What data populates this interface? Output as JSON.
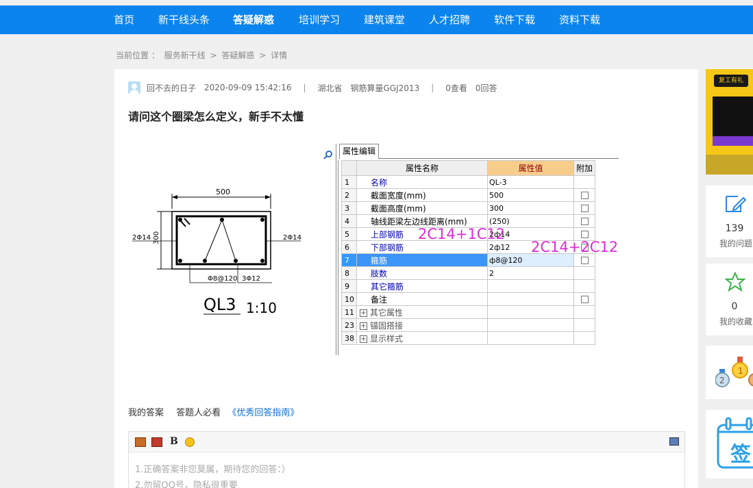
{
  "nav": {
    "items": [
      "首页",
      "新干线头条",
      "答疑解惑",
      "培训学习",
      "建筑课堂",
      "人才招聘",
      "软件下载",
      "资料下载"
    ],
    "active": "答疑解惑"
  },
  "breadcrumb": {
    "prefix": "当前位置 ：",
    "items": [
      "服务新干线",
      "答疑解惑",
      "详情"
    ],
    "sep": ">"
  },
  "question": {
    "author": "回不去的日子",
    "datetime": "2020-09-09 15:42:16",
    "location": "湖北省",
    "software": "钢筋算量GGJ2013",
    "views": "0查看",
    "answers": "0回答",
    "title": "请问这个圈梁怎么定义，新手不太懂"
  },
  "drawing": {
    "width_dim": "500",
    "height_dim": "300",
    "left_bar": "2Φ14",
    "right_bar": "2Φ14",
    "stirrup": "Φ8@120",
    "bottom_bar": "3Φ12",
    "name": "QL3",
    "scale": "1:10"
  },
  "software_panel": {
    "tab": "属性编辑",
    "headers": [
      "属性名称",
      "属性值",
      "附加"
    ],
    "rows": [
      {
        "no": "1",
        "name": "名称",
        "value": "QL-3",
        "blue": true,
        "check": false,
        "expand": false
      },
      {
        "no": "2",
        "name": "截面宽度(mm)",
        "value": "500",
        "blue": false,
        "check": true,
        "expand": false
      },
      {
        "no": "3",
        "name": "截面高度(mm)",
        "value": "300",
        "blue": false,
        "check": true,
        "expand": false
      },
      {
        "no": "4",
        "name": "轴线距梁左边线距离(mm)",
        "value": "(250)",
        "blue": false,
        "check": true,
        "expand": false
      },
      {
        "no": "5",
        "name": "上部钢筋",
        "value": "2ф14",
        "blue": true,
        "check": true,
        "expand": false
      },
      {
        "no": "6",
        "name": "下部钢筋",
        "value": "2ф12",
        "blue": true,
        "check": true,
        "expand": false
      },
      {
        "no": "7",
        "name": "箍筋",
        "value": "ф8@120",
        "blue": true,
        "check": true,
        "expand": false,
        "selected": true
      },
      {
        "no": "8",
        "name": "肢数",
        "value": "2",
        "blue": true,
        "check": false,
        "expand": false
      },
      {
        "no": "9",
        "name": "其它箍筋",
        "value": "",
        "blue": true,
        "check": false,
        "expand": false
      },
      {
        "no": "10",
        "name": "备注",
        "value": "",
        "blue": false,
        "check": true,
        "expand": false
      },
      {
        "no": "11",
        "name": "其它属性",
        "value": "",
        "blue": false,
        "check": false,
        "expand": true
      },
      {
        "no": "23",
        "name": "锚固搭接",
        "value": "",
        "blue": false,
        "check": false,
        "expand": true
      },
      {
        "no": "38",
        "name": "显示样式",
        "value": "",
        "blue": false,
        "check": false,
        "expand": true
      }
    ],
    "annotation_top": "2C14+1C12",
    "annotation_bottom": "2C14+2C12"
  },
  "answer": {
    "my_answer": "我的答案",
    "must_read": "答题人必看",
    "guide_link": "《优秀回答指南》",
    "placeholder": "1.正确答案非您莫属，期待您的回答：）\n2.勿留QQ号，隐私很重要"
  },
  "sidebar": {
    "ad_tag": "复工有礼",
    "my_questions_count": "139",
    "my_questions_label": "我的问题",
    "my_favorites_count": "0",
    "my_favorites_label": "我的收藏",
    "signin_label": "签"
  },
  "colors": {
    "nav_bg": "#0b84ee",
    "link": "#0b6fd6",
    "annotation": "#e02bd8",
    "selected_row": "#3a95f7",
    "header_value_bg": "#f7cd8c"
  }
}
